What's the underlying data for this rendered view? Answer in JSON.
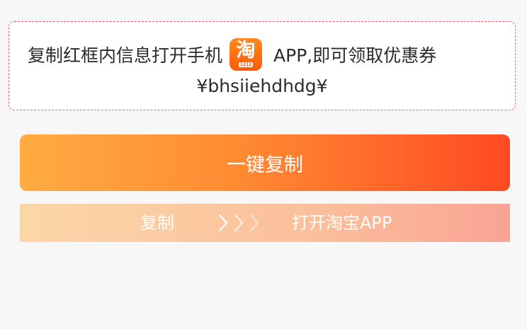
{
  "code_box": {
    "instruction_before": "复制红框内信息打开手机",
    "app_icon": {
      "name": "taobao-app-icon",
      "glyph": "淘",
      "badge": "1212"
    },
    "instruction_after": "APP,即可领取优惠券",
    "code": "¥bhsiiehdhdg¥"
  },
  "copy_button": {
    "label": "一键复制"
  },
  "steps": {
    "step1": "复制",
    "arrows_icon": "triple-chevron-right-icon",
    "step2": "打开淘宝APP"
  },
  "colors": {
    "dashed_border": "#f0606a",
    "button_gradient_start": "#ffac42",
    "button_gradient_end": "#ff4a22",
    "steps_gradient_start": "#fbd7a8",
    "steps_gradient_end": "#f9a494",
    "app_icon_orange": "#ff6a10"
  }
}
